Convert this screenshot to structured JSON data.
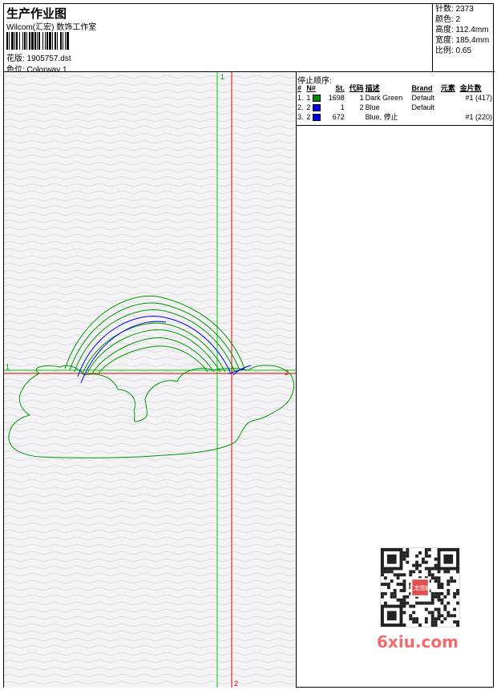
{
  "header": {
    "title": "生产作业图",
    "studio": "Wilcom(汇宏) 数饰工作室",
    "design_label": "花版: 1905757.dst",
    "colorway_label": "色位: Colorway 1"
  },
  "stats": {
    "stitches": "针数: 2373",
    "colors": "颜色: 2",
    "height": "高度: 112.4mm",
    "width": "宽度: 185.4mm",
    "scale": "比例: 0.65"
  },
  "canvas": {
    "marker_top": "1",
    "marker_left": "1",
    "marker_right": "2",
    "marker_bottom": "2",
    "colors": {
      "green_thread": "#009a00",
      "blue_thread": "#0000ee",
      "guide_green": "#00cc00",
      "guide_red": "#e00000"
    }
  },
  "sequence": {
    "title": "停止顺序:",
    "headers": [
      "#",
      "N#",
      "St.",
      "代码",
      "描述",
      "Brand",
      "元素",
      "金片数"
    ],
    "rows": [
      {
        "idx": "1.",
        "n": "1",
        "color": "#008c00",
        "st": "1698",
        "code": "1",
        "desc": "Dark Green",
        "brand": "Default",
        "elem": "",
        "seq": "#1 (417)"
      },
      {
        "idx": "2.",
        "n": "2",
        "color": "#0000ee",
        "st": "1",
        "code": "2",
        "desc": "Blue",
        "brand": "Default",
        "elem": "",
        "seq": ""
      },
      {
        "idx": "3.",
        "n": "2",
        "color": "#0000ee",
        "st": "672",
        "code": "",
        "desc": "Blue, 停止",
        "brand": "",
        "elem": "",
        "seq": "#1 (220)"
      }
    ]
  },
  "watermark": {
    "text": "6xiu.com",
    "stamp": "汇宏图稿"
  }
}
